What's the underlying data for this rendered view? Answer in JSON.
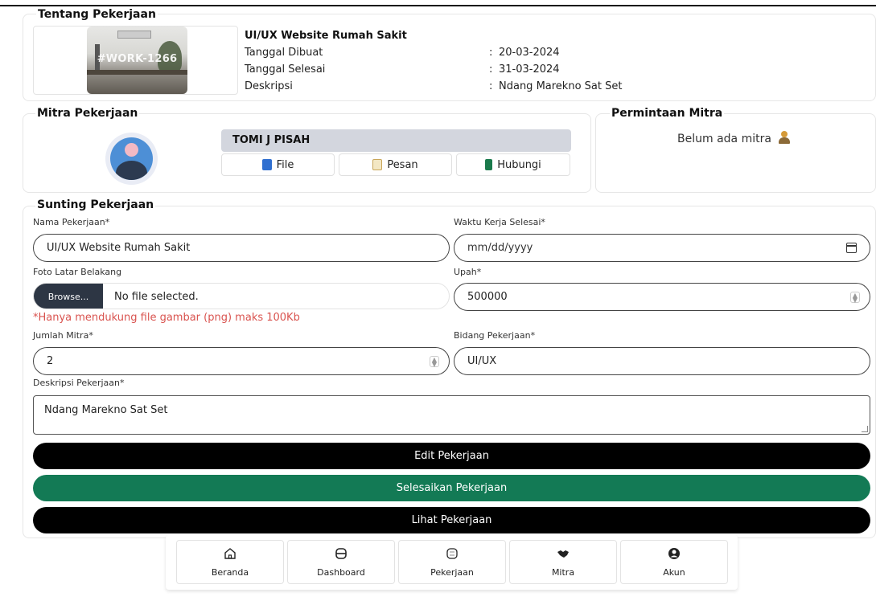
{
  "tentang": {
    "title": "Tentang Pekerjaan",
    "thumb_code": "#WORK-1266",
    "job_title": "UI/UX Website Rumah Sakit",
    "rows": [
      {
        "label": "Tanggal Dibuat",
        "sep": ":",
        "value": "20-03-2024"
      },
      {
        "label": "Tanggal Selesai",
        "sep": ":",
        "value": "31-03-2024"
      },
      {
        "label": "Deskripsi",
        "sep": ":",
        "value": "Ndang Marekno Sat Set"
      }
    ]
  },
  "mitra": {
    "title": "Mitra Pekerjaan",
    "name": "TOMI J PISAH",
    "buttons": {
      "file": "File",
      "pesan": "Pesan",
      "hubungi": "Hubungi"
    }
  },
  "permintaan": {
    "title": "Permintaan Mitra",
    "empty_text": "Belum ada mitra"
  },
  "form": {
    "title": "Sunting Pekerjaan",
    "nama_label": "Nama Pekerjaan*",
    "nama_value": "UI/UX Website Rumah Sakit",
    "waktu_label": "Waktu Kerja Selesai*",
    "waktu_placeholder": "mm/dd/yyyy",
    "foto_label": "Foto Latar Belakang",
    "browse_label": "Browse...",
    "file_status": "No file selected.",
    "foto_hint": "*Hanya mendukung file gambar (png) maks 100Kb",
    "upah_label": "Upah*",
    "upah_value": "500000",
    "jumlah_label": "Jumlah Mitra*",
    "jumlah_value": "2",
    "bidang_label": "Bidang Pekerjaan*",
    "bidang_value": "UI/UX",
    "deskripsi_label": "Deskripsi Pekerjaan*",
    "deskripsi_value": "Ndang Marekno Sat Set"
  },
  "actions": {
    "edit": "Edit Pekerjaan",
    "selesaikan": "Selesaikan Pekerjaan",
    "lihat": "Lihat Pekerjaan"
  },
  "colors": {
    "primary_black": "#000000",
    "success_green": "#137a55",
    "warning_red": "#d9534f"
  },
  "nav": {
    "items": [
      {
        "label": "Beranda",
        "icon": "home-icon"
      },
      {
        "label": "Dashboard",
        "icon": "dashboard-icon"
      },
      {
        "label": "Pekerjaan",
        "icon": "pekerjaan-icon"
      },
      {
        "label": "Mitra",
        "icon": "handshake-icon"
      },
      {
        "label": "Akun",
        "icon": "account-icon"
      }
    ]
  }
}
